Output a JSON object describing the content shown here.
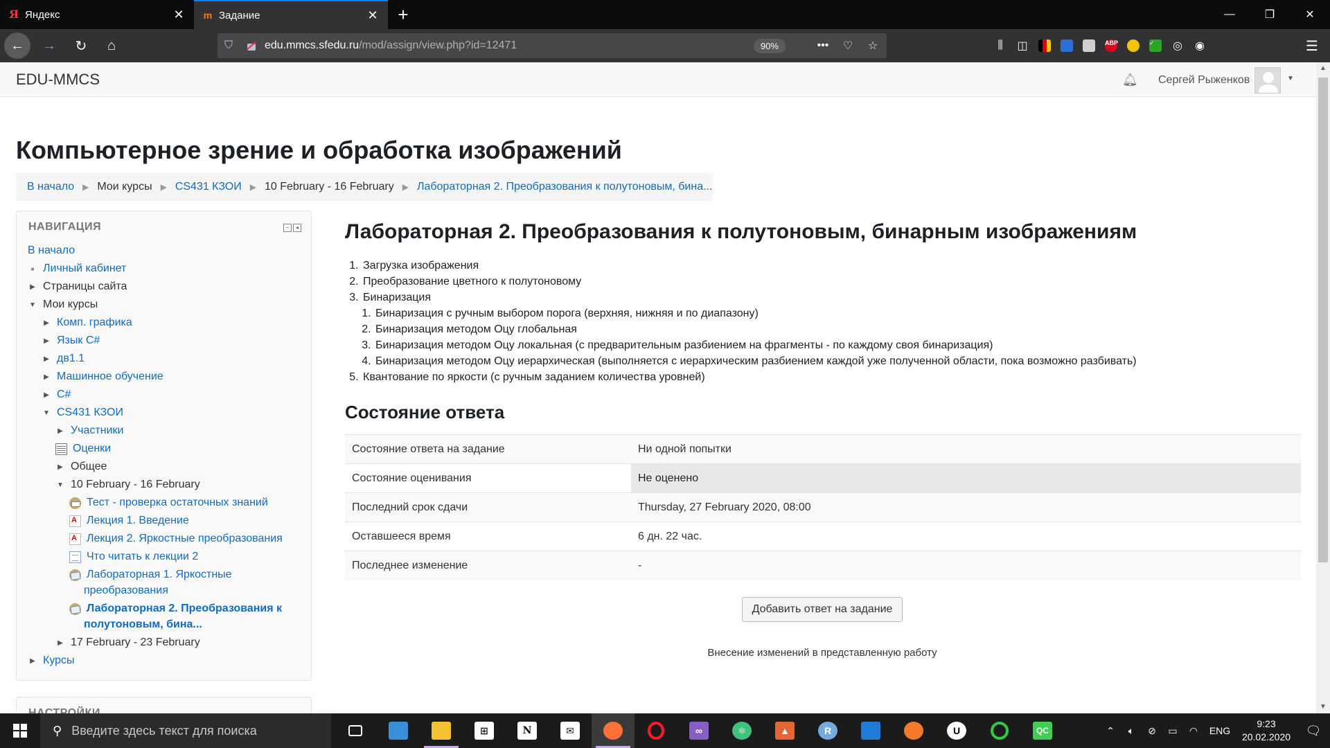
{
  "browser": {
    "tabs": [
      {
        "title": "Яндекс",
        "active": false,
        "favicon": "yandex-icon"
      },
      {
        "title": "Задание",
        "active": true,
        "favicon": "moodle-icon"
      }
    ],
    "url_host": "edu.mmcs.sfedu.ru",
    "url_path": "/mod/assign/view.php?id=12471",
    "zoom": "90%"
  },
  "header": {
    "brand": "EDU-MMCS",
    "user_name": "Сергей Рыженков"
  },
  "page": {
    "title": "Компьютерное зрение и обработка изображений",
    "breadcrumbs": [
      {
        "label": "В начало",
        "link": true
      },
      {
        "label": "Мои курсы",
        "link": false
      },
      {
        "label": "CS431 КЗОИ",
        "link": true
      },
      {
        "label": "10 February - 16 February",
        "link": false
      },
      {
        "label": "Лабораторная 2. Преобразования к полутоновым, бина...",
        "link": true
      }
    ]
  },
  "nav": {
    "title": "НАВИГАЦИЯ",
    "items": [
      {
        "label": "В начало"
      },
      {
        "label": "Личный кабинет"
      },
      {
        "label": "Страницы сайта"
      },
      {
        "label": "Мои курсы"
      },
      {
        "label": "Комп. графика"
      },
      {
        "label": "Язык C#"
      },
      {
        "label": "дв1.1"
      },
      {
        "label": "Машинное обучение"
      },
      {
        "label": "C#"
      },
      {
        "label": "CS431 КЗОИ"
      },
      {
        "label": "Участники"
      },
      {
        "label": "Оценки"
      },
      {
        "label": "Общее"
      },
      {
        "label": "10 February - 16 February"
      },
      {
        "label": "Тест - проверка остаточных знаний"
      },
      {
        "label": "Лекция 1. Введение"
      },
      {
        "label": "Лекция 2. Яркостные преобразования"
      },
      {
        "label": "Что читать к лекции 2"
      },
      {
        "label": "Лабораторная 1. Яркостные"
      },
      {
        "label": "преобразования"
      },
      {
        "label": "Лабораторная 2. Преобразования к"
      },
      {
        "label": "полутоновым, бина..."
      },
      {
        "label": "17 February - 23 February"
      },
      {
        "label": "Курсы"
      }
    ],
    "next_block_title": "НАСТРОЙКИ"
  },
  "assignment": {
    "title": "Лабораторная 2. Преобразования к полутоновым, бинарным изображениям",
    "tasks": [
      "Загрузка изображения",
      "Преобразование цветного к полутоновому",
      "Бинаризация",
      "Квантование по яркости (с ручным заданием количества уровней)"
    ],
    "subtasks": [
      "Бинаризация с ручным выбором порога (верхняя, нижняя и по диапазону)",
      "Бинаризация методом Оцу глобальная",
      "Бинаризация методом Оцу локальная (с предварительным разбиением на фрагменты - по каждому своя бинаризация)",
      "Бинаризация методом Оцу иерархическая (выполняется с иерархическим разбиением каждой уже полученной  области, пока возможно разбивать)"
    ],
    "status_title": "Состояние ответа",
    "status_rows": [
      {
        "key": "Состояние ответа на задание",
        "value": "Ни одной попытки"
      },
      {
        "key": "Состояние оценивания",
        "value": "Не оценено"
      },
      {
        "key": "Последний срок сдачи",
        "value": "Thursday, 27 February 2020, 08:00"
      },
      {
        "key": "Оставшееся время",
        "value": "6 дн. 22 час."
      },
      {
        "key": "Последнее изменение",
        "value": "-"
      }
    ],
    "add_button": "Добавить ответ на задание",
    "note": "Внесение изменений в представленную работу"
  },
  "taskbar": {
    "search_placeholder": "Введите здесь текст для поиска",
    "lang": "ENG",
    "time": "9:23",
    "date": "20.02.2020"
  },
  "colors": {
    "link": "#0f6cbf",
    "tab_accent": "#0a84ff",
    "taskbar": "#1b1b1b"
  }
}
